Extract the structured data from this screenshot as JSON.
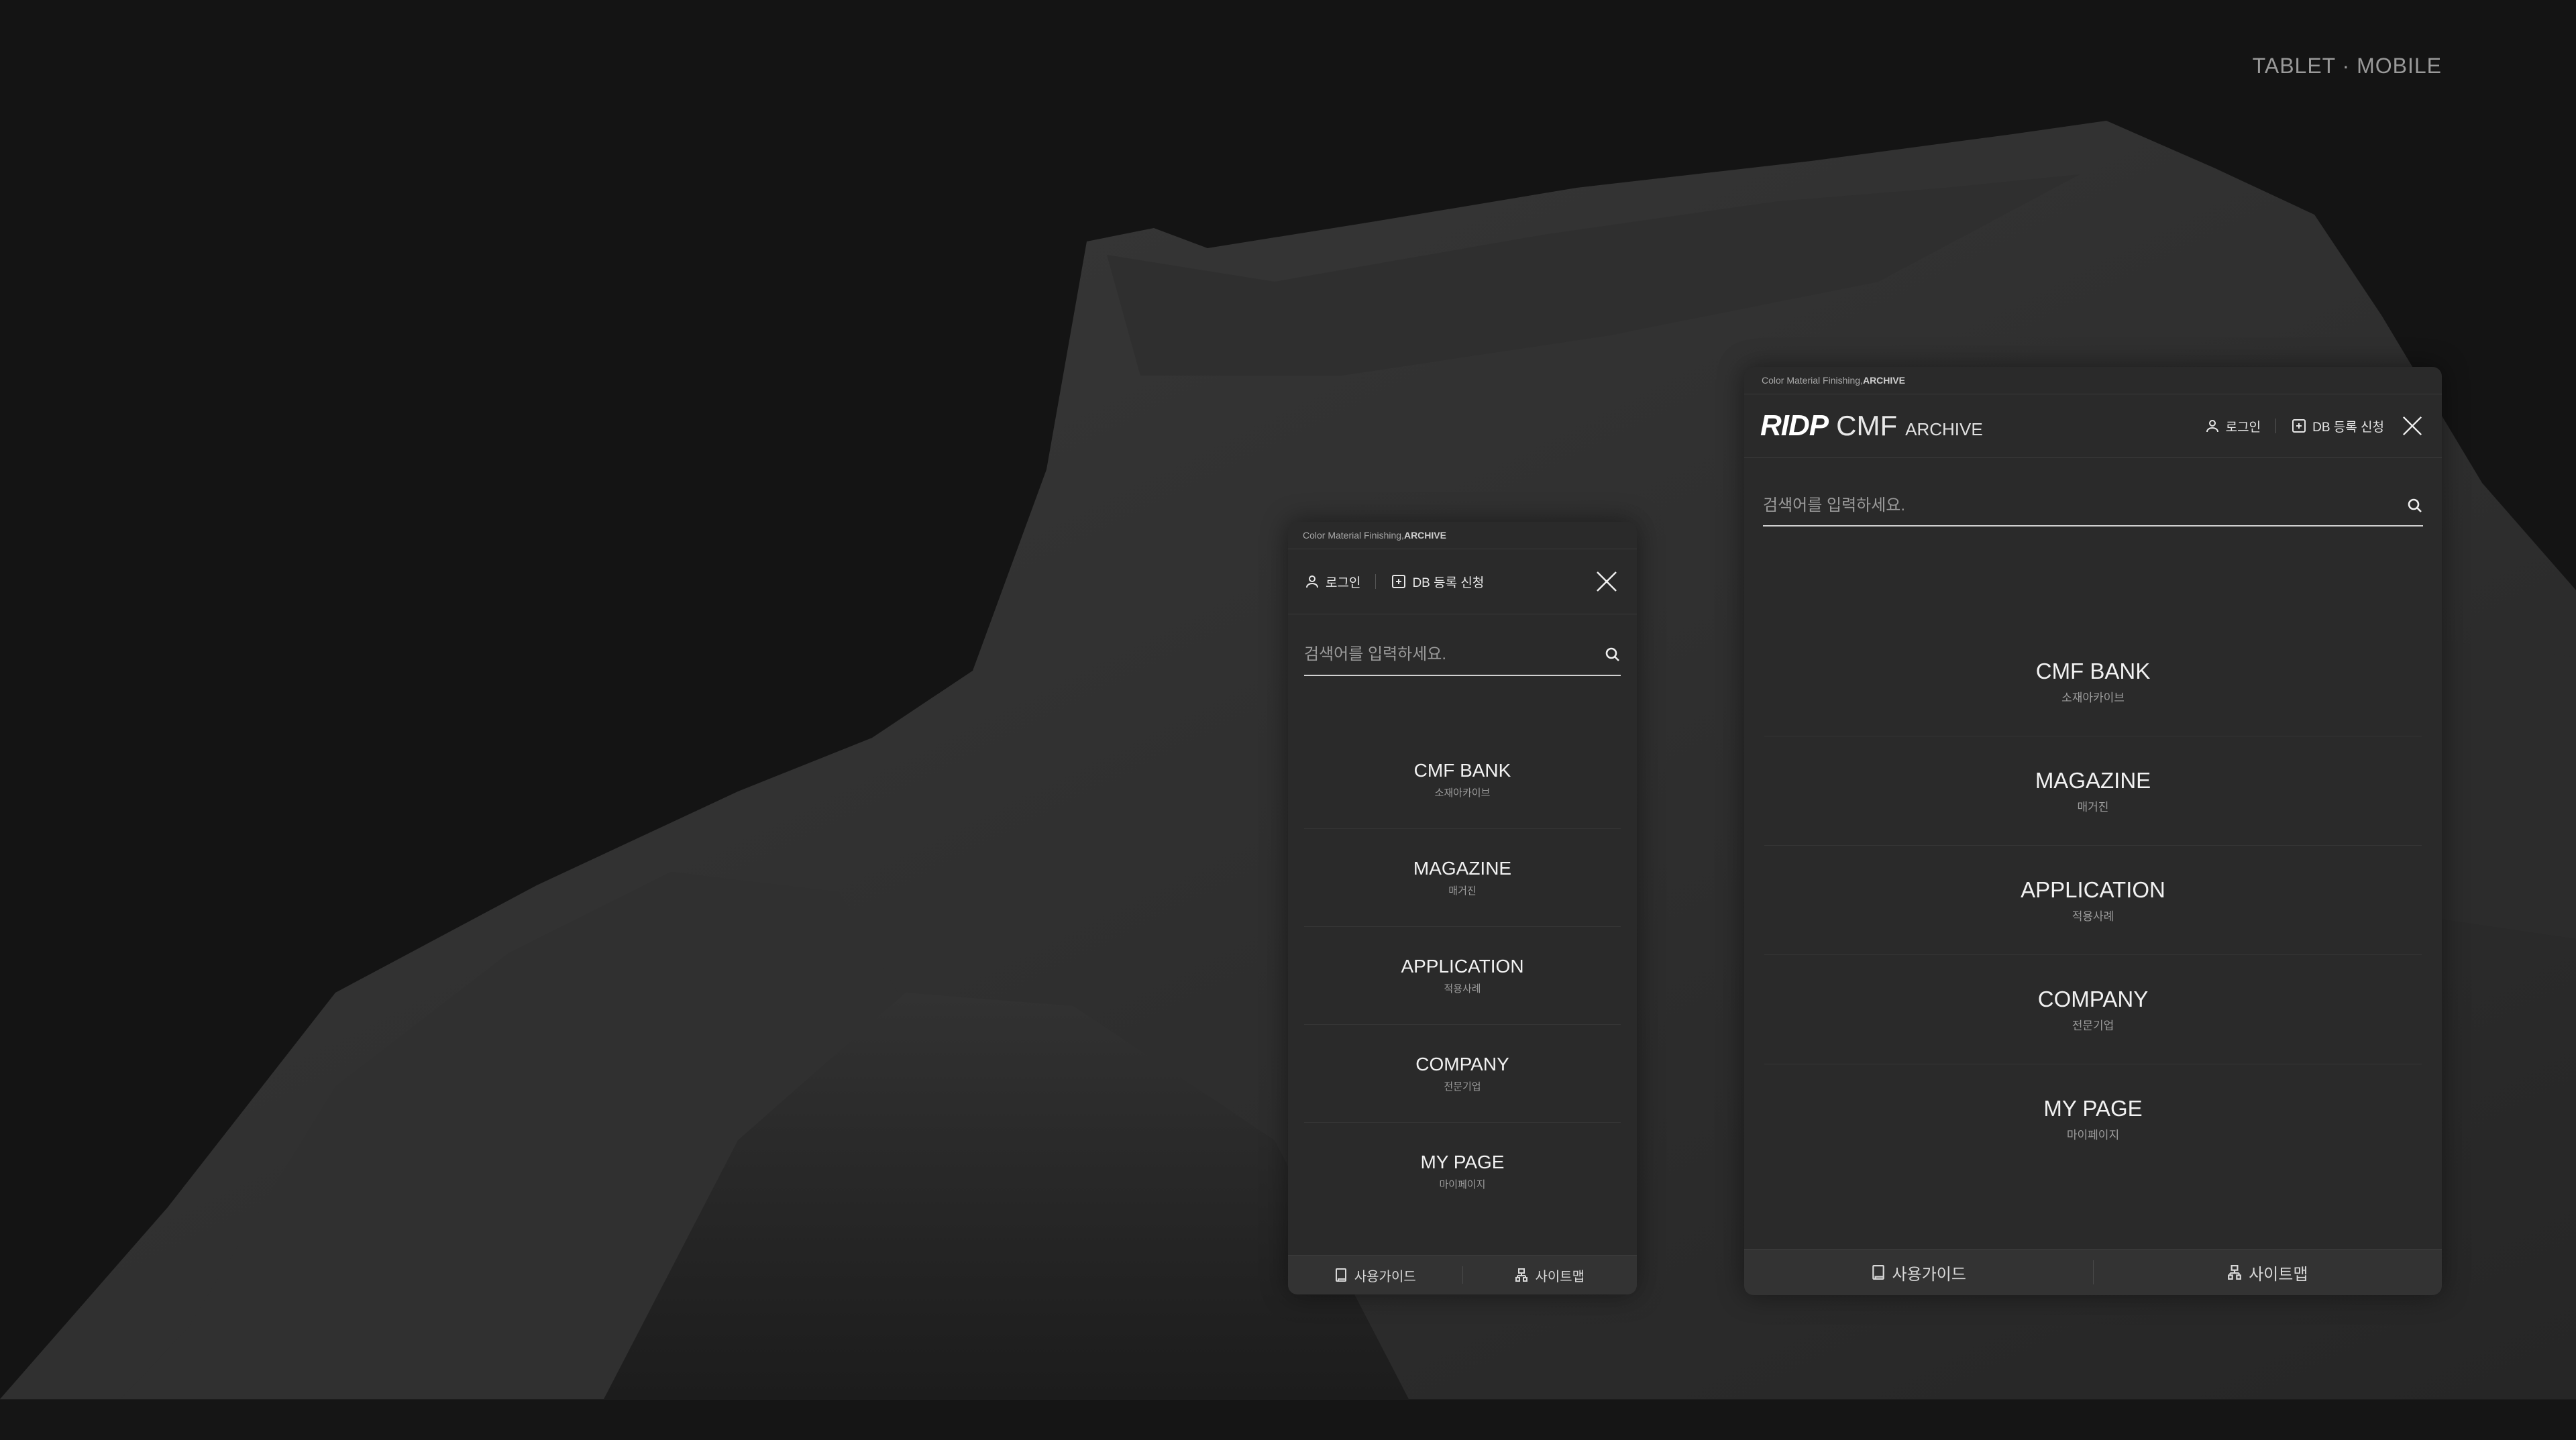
{
  "corner_label": "TABLET · MOBILE",
  "mobile": {
    "tagline_prefix": "Color Material Finishing, ",
    "tagline_bold": "ARCHIVE",
    "login": "로그인",
    "db_register": "DB 등록 신청",
    "search_placeholder": "검색어를 입력하세요.",
    "menu": [
      {
        "title": "CMF BANK",
        "sub": "소재아카이브"
      },
      {
        "title": "MAGAZINE",
        "sub": "매거진"
      },
      {
        "title": "APPLICATION",
        "sub": "적용사례"
      },
      {
        "title": "COMPANY",
        "sub": "전문기업"
      },
      {
        "title": "MY PAGE",
        "sub": "마이페이지"
      }
    ],
    "footer": {
      "guide": "사용가이드",
      "sitemap": "사이트맵"
    }
  },
  "tablet": {
    "tagline_prefix": "Color Material Finishing, ",
    "tagline_bold": "ARCHIVE",
    "logo": {
      "brand": "RIDP",
      "cmf": "CMF",
      "archive": "ARCHIVE"
    },
    "login": "로그인",
    "db_register": "DB 등록 신청",
    "search_placeholder": "검색어를 입력하세요.",
    "menu": [
      {
        "title": "CMF BANK",
        "sub": "소재아카이브"
      },
      {
        "title": "MAGAZINE",
        "sub": "매거진"
      },
      {
        "title": "APPLICATION",
        "sub": "적용사례"
      },
      {
        "title": "COMPANY",
        "sub": "전문기업"
      },
      {
        "title": "MY PAGE",
        "sub": "마이페이지"
      }
    ],
    "footer": {
      "guide": "사용가이드",
      "sitemap": "사이트맵"
    }
  },
  "icons": {
    "user": "user-icon",
    "register": "plus-square-icon",
    "close": "close-icon",
    "search": "search-icon",
    "guide": "book-icon",
    "sitemap": "sitemap-icon"
  },
  "colors": {
    "background": "#141414",
    "panel": "#2a2a2a",
    "footer": "#333333",
    "text": "#f0f0f0",
    "muted": "#9c9c9c"
  }
}
